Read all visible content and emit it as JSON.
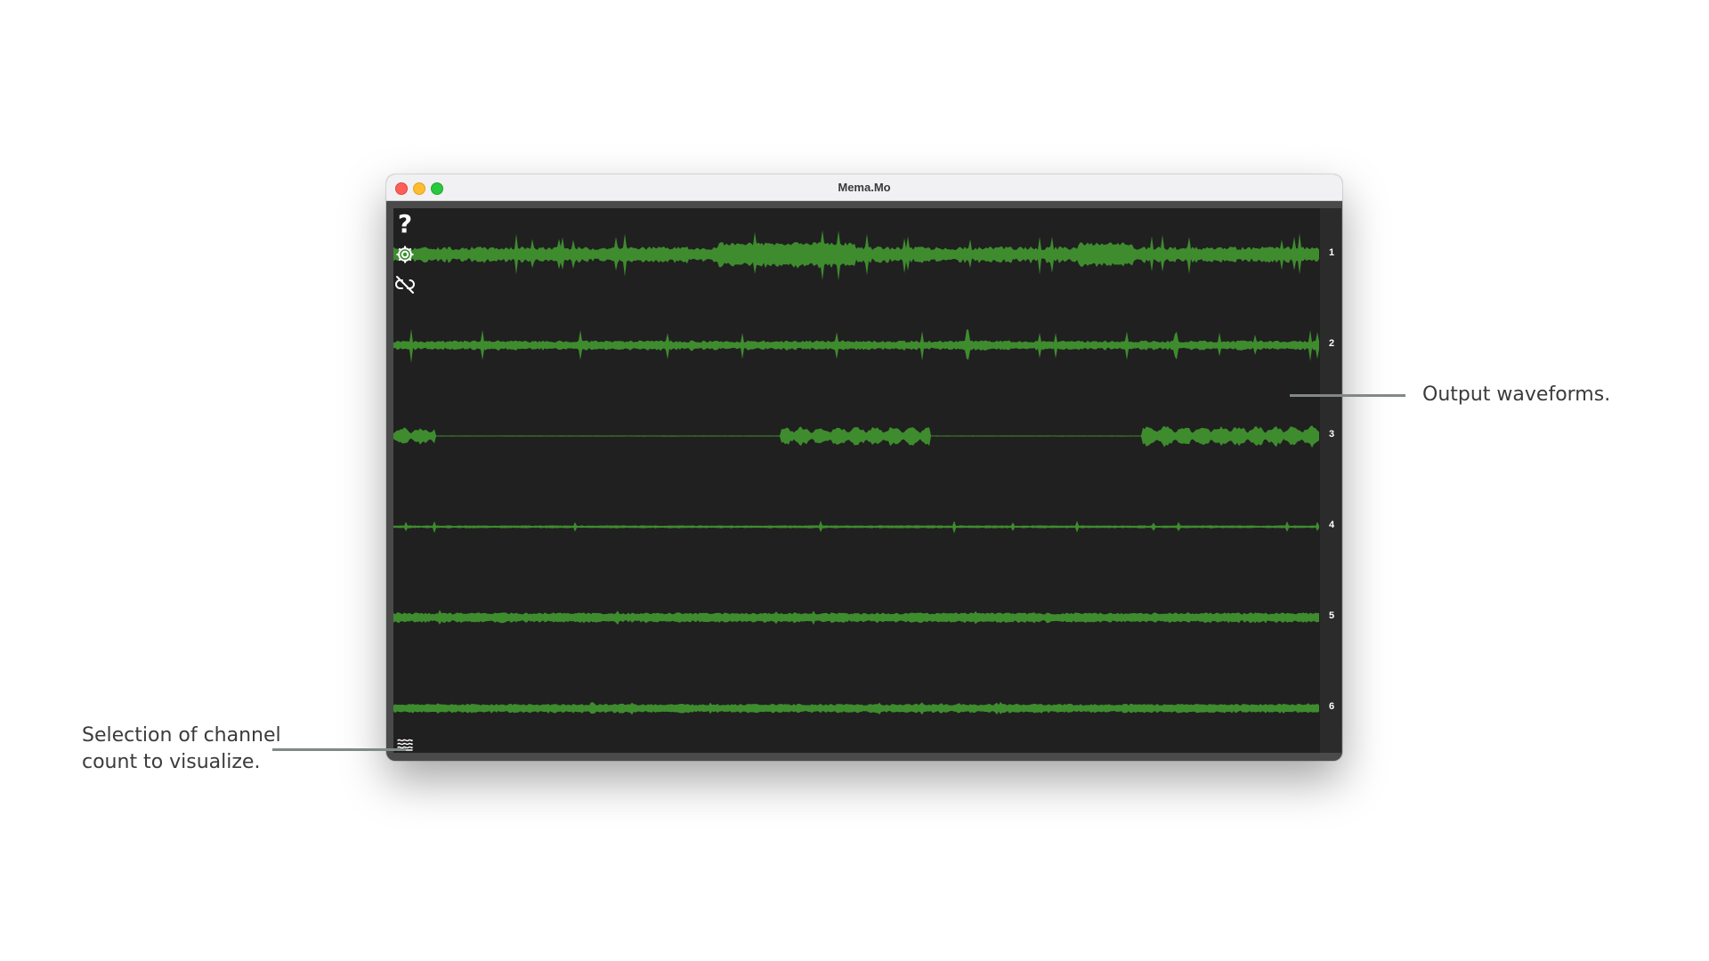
{
  "window": {
    "title": "Mema.Mo"
  },
  "toolbar": {
    "help_icon": "?",
    "settings_icon": "gear-icon",
    "unlink_icon": "unlink-icon",
    "channel_select_icon": "waves-icon"
  },
  "channels": [
    {
      "label": "1"
    },
    {
      "label": "2"
    },
    {
      "label": "3"
    },
    {
      "label": "4"
    },
    {
      "label": "5"
    },
    {
      "label": "6"
    }
  ],
  "colors": {
    "waveform": "#3e8c2e",
    "background": "#202020"
  },
  "annotations": {
    "output": "Output waveforms.",
    "selection_line1": "Selection of channel",
    "selection_line2": "count to visualize."
  }
}
